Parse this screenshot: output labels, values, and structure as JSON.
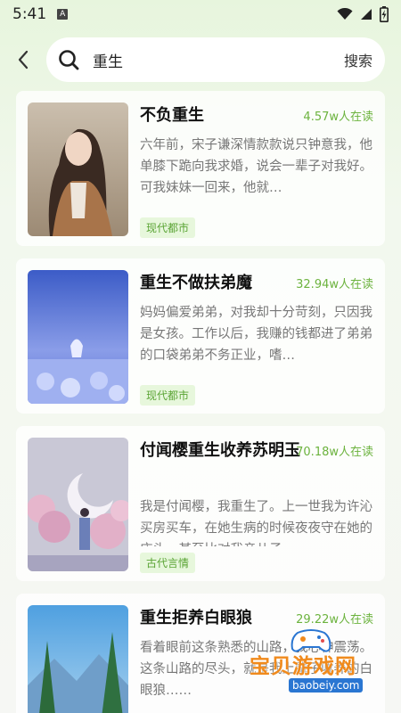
{
  "status_bar": {
    "time": "5:41",
    "notif_badge": "A"
  },
  "search": {
    "query": "重生",
    "button_label": "搜索"
  },
  "books": [
    {
      "title": "不负重生",
      "readers": "4.57w人在读",
      "description": "六年前，宋子谦深情款款说只钟意我，他单膝下跪向我求婚，说会一辈子对我好。可我妹妹一回来，他就…",
      "tag": "现代都市"
    },
    {
      "title": "重生不做扶弟魔",
      "readers": "32.94w人在读",
      "description": "妈妈偏爱弟弟，对我却十分苛刻，只因我是女孩。工作以后，我赚的钱都进了弟弟的口袋弟弟不务正业，嗜…",
      "tag": "现代都市"
    },
    {
      "title": "付闻樱重生收养苏明玉",
      "readers": "70.18w人在读",
      "description": "我是付闻樱，我重生了。上一世我为许沁买房买车，在她生病的时候夜夜守在她的床头。甚至比对我亲儿子…",
      "tag": "古代言情"
    },
    {
      "title": "重生拒养白眼狼",
      "readers": "29.22w人在读",
      "description": "看着眼前这条熟悉的山路，我心神震荡。这条山路的尽头，就是我上辈子收养的白眼狼……",
      "tag": ""
    }
  ],
  "watermark": {
    "title": "宝贝游戏网",
    "url": "baobeiy.com"
  },
  "colors": {
    "accent": "#6cb33e",
    "tag_bg": "#e7f7dc",
    "tag_text": "#5aa434"
  }
}
